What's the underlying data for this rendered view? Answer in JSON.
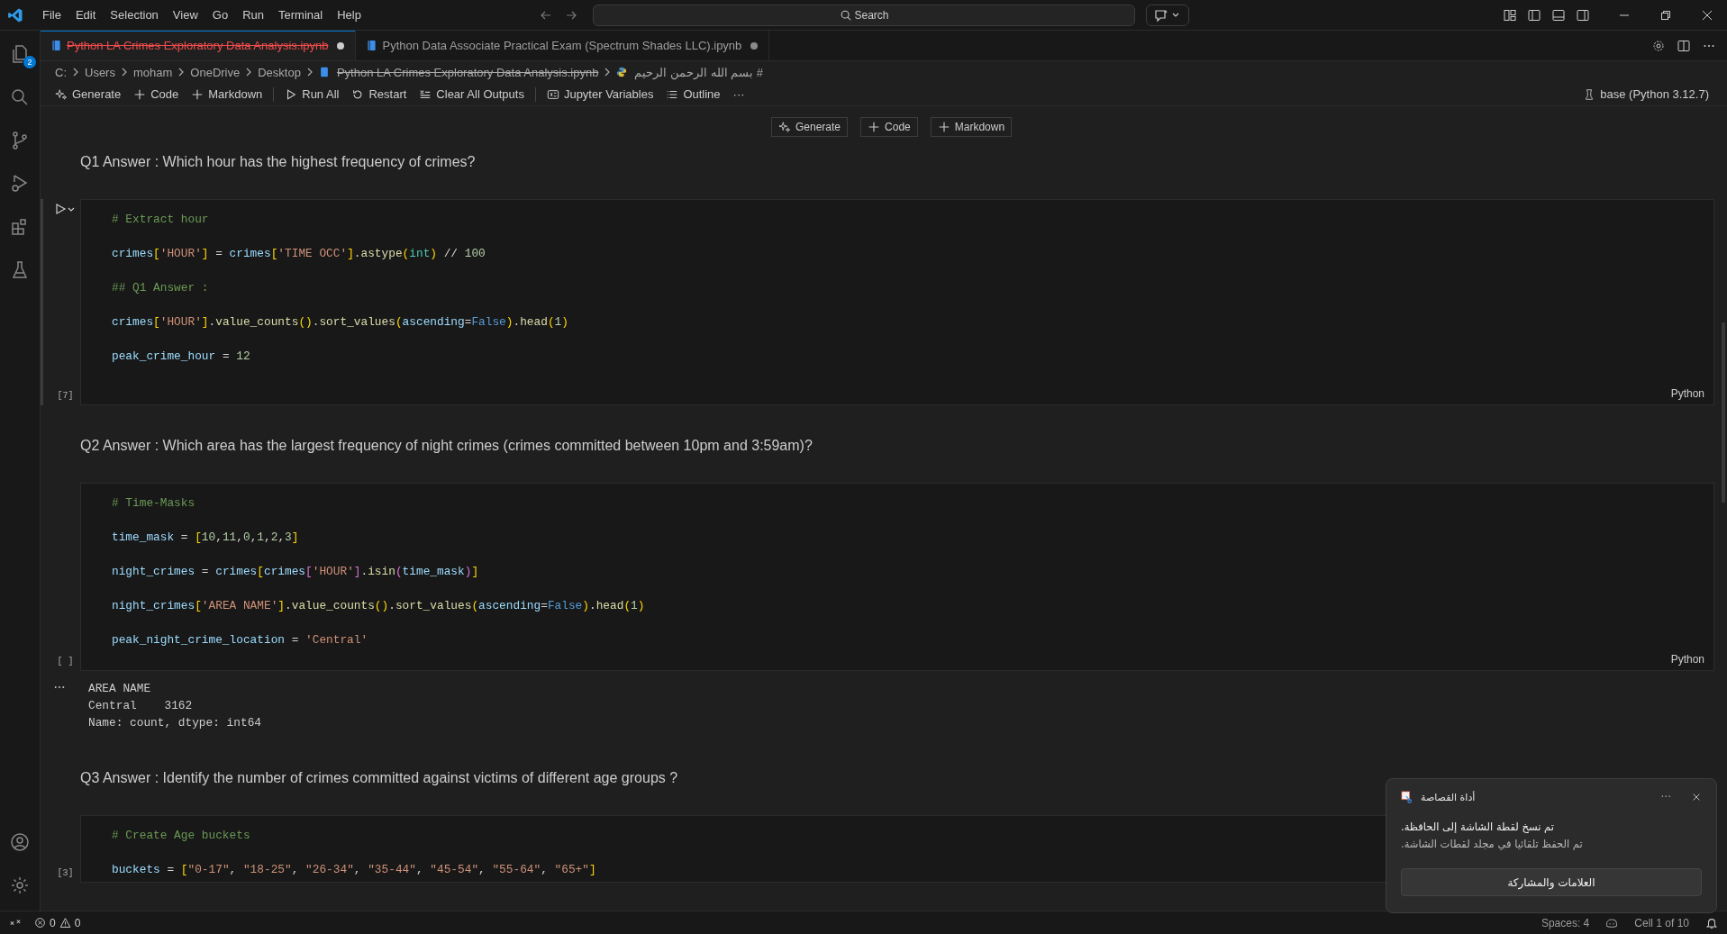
{
  "title_bar": {
    "menu": [
      "File",
      "Edit",
      "Selection",
      "View",
      "Go",
      "Run",
      "Terminal",
      "Help"
    ],
    "search": {
      "placeholder": "Search"
    }
  },
  "activity_bar": {
    "top": [
      {
        "kind": "explorer",
        "badge": "2"
      },
      {
        "kind": "search"
      },
      {
        "kind": "source-control"
      },
      {
        "kind": "run-debug"
      },
      {
        "kind": "extensions"
      },
      {
        "kind": "testing"
      }
    ],
    "bottom": [
      {
        "kind": "account"
      },
      {
        "kind": "settings"
      }
    ]
  },
  "tabs": [
    {
      "label": "Python LA Crimes Exploratory Data Analysis.ipynb",
      "selected": true,
      "deleted": true,
      "dirty": true
    },
    {
      "label": "Python Data Associate Practical Exam (Spectrum Shades LLC).ipynb",
      "selected": false,
      "deleted": false,
      "dirty": true
    }
  ],
  "breadcrumb": [
    {
      "label": "C:",
      "kind": "folder",
      "deleted": false
    },
    {
      "label": "Users",
      "kind": "folder",
      "deleted": false
    },
    {
      "label": "moham",
      "kind": "folder",
      "deleted": false
    },
    {
      "label": "OneDrive",
      "kind": "folder",
      "deleted": false
    },
    {
      "label": "Desktop",
      "kind": "folder",
      "deleted": false
    },
    {
      "label": "Python LA Crimes Exploratory Data Analysis.ipynb",
      "kind": "file",
      "deleted": true
    },
    {
      "label": "# بسم الله الرحمن الرحيم",
      "kind": "symbol",
      "deleted": false
    }
  ],
  "notebook_toolbar": {
    "items": [
      "Generate",
      "Code",
      "Markdown",
      "Run All",
      "Restart",
      "Clear All Outputs",
      "Jupyter Variables",
      "Outline"
    ],
    "more": "···",
    "kernel": "base (Python 3.12.7)"
  },
  "cell_toolbar": [
    "Generate",
    "Code",
    "Markdown"
  ],
  "cells": [
    {
      "kind": "markdown",
      "text": "Q1 Answer : Which hour has the highest frequency of crimes?"
    },
    {
      "kind": "code",
      "focused": true,
      "execution_count": "[7]",
      "language": "Python",
      "lines": [
        [
          {
            "kind": "comment",
            "text": "# Extract hour"
          }
        ],
        [
          {
            "kind": "var",
            "text": "crimes"
          },
          {
            "kind": "b1",
            "text": "["
          },
          {
            "kind": "str",
            "text": "'HOUR'"
          },
          {
            "kind": "b1",
            "text": "]"
          },
          {
            "kind": "op",
            "text": " = "
          },
          {
            "kind": "var",
            "text": "crimes"
          },
          {
            "kind": "b1",
            "text": "["
          },
          {
            "kind": "str",
            "text": "'TIME OCC'"
          },
          {
            "kind": "b1",
            "text": "]"
          },
          {
            "kind": "op",
            "text": "."
          },
          {
            "kind": "func",
            "text": "astype"
          },
          {
            "kind": "b1",
            "text": "("
          },
          {
            "kind": "cls",
            "text": "int"
          },
          {
            "kind": "b1",
            "text": ")"
          },
          {
            "kind": "op",
            "text": " // "
          },
          {
            "kind": "num",
            "text": "100"
          }
        ],
        [
          {
            "kind": "comment",
            "text": "## Q1 Answer :"
          }
        ],
        [
          {
            "kind": "var",
            "text": "crimes"
          },
          {
            "kind": "b1",
            "text": "["
          },
          {
            "kind": "str",
            "text": "'HOUR'"
          },
          {
            "kind": "b1",
            "text": "]"
          },
          {
            "kind": "op",
            "text": "."
          },
          {
            "kind": "func",
            "text": "value_counts"
          },
          {
            "kind": "b1",
            "text": "()"
          },
          {
            "kind": "op",
            "text": "."
          },
          {
            "kind": "func",
            "text": "sort_values"
          },
          {
            "kind": "b1",
            "text": "("
          },
          {
            "kind": "var",
            "text": "ascending"
          },
          {
            "kind": "op",
            "text": "="
          },
          {
            "kind": "const",
            "text": "False"
          },
          {
            "kind": "b1",
            "text": ")"
          },
          {
            "kind": "op",
            "text": "."
          },
          {
            "kind": "func",
            "text": "head"
          },
          {
            "kind": "b1",
            "text": "("
          },
          {
            "kind": "num",
            "text": "1"
          },
          {
            "kind": "b1",
            "text": ")"
          }
        ],
        [
          {
            "kind": "var",
            "text": "peak_crime_hour"
          },
          {
            "kind": "op",
            "text": " = "
          },
          {
            "kind": "num",
            "text": "12"
          }
        ]
      ]
    },
    {
      "kind": "markdown",
      "text": "Q2 Answer : Which area has the largest frequency of night crimes (crimes committed between 10pm and 3:59am)?"
    },
    {
      "kind": "code",
      "focused": false,
      "execution_count": "[ ]",
      "language": "Python",
      "lines": [
        [
          {
            "kind": "comment",
            "text": "# Time-Masks"
          }
        ],
        [
          {
            "kind": "var",
            "text": "time_mask"
          },
          {
            "kind": "op",
            "text": " = "
          },
          {
            "kind": "b1",
            "text": "["
          },
          {
            "kind": "num",
            "text": "10"
          },
          {
            "kind": "op",
            "text": ","
          },
          {
            "kind": "num",
            "text": "11"
          },
          {
            "kind": "op",
            "text": ","
          },
          {
            "kind": "num",
            "text": "0"
          },
          {
            "kind": "op",
            "text": ","
          },
          {
            "kind": "num",
            "text": "1"
          },
          {
            "kind": "op",
            "text": ","
          },
          {
            "kind": "num",
            "text": "2"
          },
          {
            "kind": "op",
            "text": ","
          },
          {
            "kind": "num",
            "text": "3"
          },
          {
            "kind": "b1",
            "text": "]"
          }
        ],
        [
          {
            "kind": "var",
            "text": "night_crimes"
          },
          {
            "kind": "op",
            "text": " = "
          },
          {
            "kind": "var",
            "text": "crimes"
          },
          {
            "kind": "b1",
            "text": "["
          },
          {
            "kind": "var",
            "text": "crimes"
          },
          {
            "kind": "b2",
            "text": "["
          },
          {
            "kind": "str",
            "text": "'HOUR'"
          },
          {
            "kind": "b2",
            "text": "]"
          },
          {
            "kind": "op",
            "text": "."
          },
          {
            "kind": "func",
            "text": "isin"
          },
          {
            "kind": "b2",
            "text": "("
          },
          {
            "kind": "var",
            "text": "time_mask"
          },
          {
            "kind": "b2",
            "text": ")"
          },
          {
            "kind": "b1",
            "text": "]"
          }
        ],
        [
          {
            "kind": "var",
            "text": "night_crimes"
          },
          {
            "kind": "b1",
            "text": "["
          },
          {
            "kind": "str",
            "text": "'AREA NAME'"
          },
          {
            "kind": "b1",
            "text": "]"
          },
          {
            "kind": "op",
            "text": "."
          },
          {
            "kind": "func",
            "text": "value_counts"
          },
          {
            "kind": "b1",
            "text": "()"
          },
          {
            "kind": "op",
            "text": "."
          },
          {
            "kind": "func",
            "text": "sort_values"
          },
          {
            "kind": "b1",
            "text": "("
          },
          {
            "kind": "var",
            "text": "ascending"
          },
          {
            "kind": "op",
            "text": "="
          },
          {
            "kind": "const",
            "text": "False"
          },
          {
            "kind": "b1",
            "text": ")"
          },
          {
            "kind": "op",
            "text": "."
          },
          {
            "kind": "func",
            "text": "head"
          },
          {
            "kind": "b1",
            "text": "("
          },
          {
            "kind": "num",
            "text": "1"
          },
          {
            "kind": "b1",
            "text": ")"
          }
        ],
        [
          {
            "kind": "var",
            "text": "peak_night_crime_location"
          },
          {
            "kind": "op",
            "text": " = "
          },
          {
            "kind": "str",
            "text": "'Central'"
          }
        ]
      ],
      "output": [
        "AREA NAME",
        "Central    3162",
        "Name: count, dtype: int64"
      ]
    },
    {
      "kind": "markdown",
      "text": "Q3 Answer : Identify the number of crimes committed against victims of different age groups ?"
    },
    {
      "kind": "code",
      "focused": false,
      "execution_count": "[3]",
      "lines": [
        [
          {
            "kind": "comment",
            "text": "# Create Age buckets"
          }
        ],
        [
          {
            "kind": "var",
            "text": "buckets"
          },
          {
            "kind": "op",
            "text": " = "
          },
          {
            "kind": "b1",
            "text": "["
          },
          {
            "kind": "str",
            "text": "\"0-17\""
          },
          {
            "kind": "op",
            "text": ", "
          },
          {
            "kind": "str",
            "text": "\"18-25\""
          },
          {
            "kind": "op",
            "text": ", "
          },
          {
            "kind": "str",
            "text": "\"26-34\""
          },
          {
            "kind": "op",
            "text": ", "
          },
          {
            "kind": "str",
            "text": "\"35-44\""
          },
          {
            "kind": "op",
            "text": ", "
          },
          {
            "kind": "str",
            "text": "\"45-54\""
          },
          {
            "kind": "op",
            "text": ", "
          },
          {
            "kind": "str",
            "text": "\"55-64\""
          },
          {
            "kind": "op",
            "text": ", "
          },
          {
            "kind": "str",
            "text": "\"65+\""
          },
          {
            "kind": "b1",
            "text": "]"
          }
        ]
      ]
    }
  ],
  "status_bar": {
    "errors": "0",
    "warnings": "0",
    "spaces": "Spaces: 4",
    "cell": "Cell 1 of 10"
  },
  "toast": {
    "app": "أداة القصاصة",
    "more": "···",
    "lines": [
      "تم نسخ لقطة الشاشة إلى الحافظة.",
      "تم الحفظ تلقائيا في مجلد لقطات الشاشة."
    ],
    "button": "العلامات والمشاركة"
  }
}
